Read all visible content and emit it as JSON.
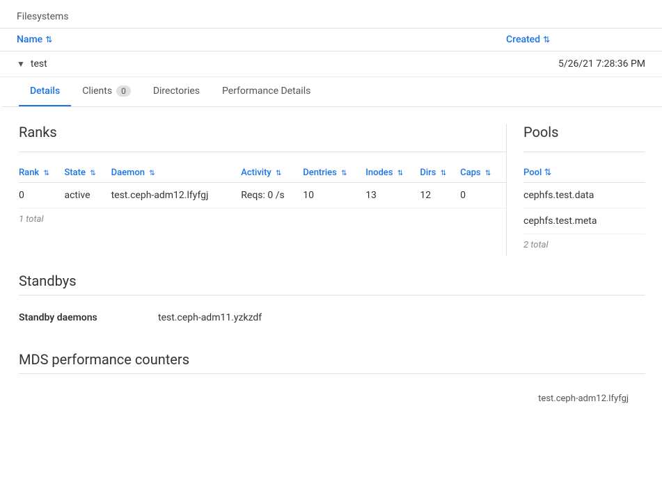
{
  "header": {
    "breadcrumb": "Filesystems"
  },
  "table": {
    "name_col": "Name",
    "created_col": "Created",
    "filesystem": {
      "name": "test",
      "created": "5/26/21 7:28:36 PM"
    }
  },
  "tabs": [
    {
      "id": "details",
      "label": "Details",
      "active": true,
      "badge": null
    },
    {
      "id": "clients",
      "label": "Clients",
      "active": false,
      "badge": "0"
    },
    {
      "id": "directories",
      "label": "Directories",
      "active": false,
      "badge": null
    },
    {
      "id": "performance-details",
      "label": "Performance Details",
      "active": false,
      "badge": null
    }
  ],
  "ranks": {
    "section_title": "Ranks",
    "columns": [
      {
        "id": "rank",
        "label": "Rank"
      },
      {
        "id": "state",
        "label": "State"
      },
      {
        "id": "daemon",
        "label": "Daemon"
      },
      {
        "id": "activity",
        "label": "Activity"
      },
      {
        "id": "dentries",
        "label": "Dentries"
      },
      {
        "id": "inodes",
        "label": "Inodes"
      },
      {
        "id": "dirs",
        "label": "Dirs"
      },
      {
        "id": "caps",
        "label": "Caps"
      }
    ],
    "rows": [
      {
        "rank": "0",
        "state": "active",
        "daemon": "test.ceph-adm12.lfyfgj",
        "activity": "Reqs: 0 /s",
        "dentries": "10",
        "inodes": "13",
        "dirs": "12",
        "caps": "0"
      }
    ],
    "total": "1 total"
  },
  "pools": {
    "section_title": "Pools",
    "columns": [
      {
        "id": "pool",
        "label": "Pool"
      }
    ],
    "rows": [
      {
        "pool": "cephfs.test.data"
      },
      {
        "pool": "cephfs.test.meta"
      }
    ],
    "total": "2 total"
  },
  "standbys": {
    "section_title": "Standbys",
    "label": "Standby daemons",
    "value": "test.ceph-adm11.yzkzdf"
  },
  "mds": {
    "section_title": "MDS performance counters",
    "daemon_label": "test.ceph-adm12.lfyfgj"
  }
}
